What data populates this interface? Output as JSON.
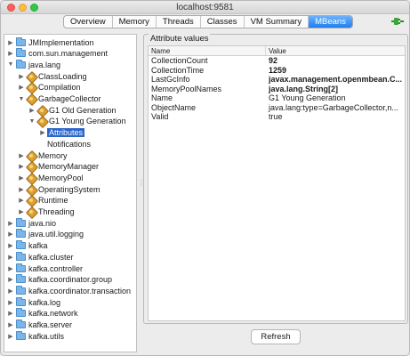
{
  "window": {
    "title": "localhost:9581"
  },
  "tabs": [
    {
      "label": "Overview",
      "active": false
    },
    {
      "label": "Memory",
      "active": false
    },
    {
      "label": "Threads",
      "active": false
    },
    {
      "label": "Classes",
      "active": false
    },
    {
      "label": "VM Summary",
      "active": false
    },
    {
      "label": "MBeans",
      "active": true
    }
  ],
  "tree": [
    {
      "label": "JMImplementation",
      "depth": 0,
      "expanded": false,
      "icon": "folder-icon"
    },
    {
      "label": "com.sun.management",
      "depth": 0,
      "expanded": false,
      "icon": "folder-icon"
    },
    {
      "label": "java.lang",
      "depth": 0,
      "expanded": true,
      "icon": "folder-icon"
    },
    {
      "label": "ClassLoading",
      "depth": 1,
      "expanded": false,
      "icon": "bean-icon"
    },
    {
      "label": "Compilation",
      "depth": 1,
      "expanded": false,
      "icon": "bean-icon"
    },
    {
      "label": "GarbageCollector",
      "depth": 1,
      "expanded": true,
      "icon": "bean-icon"
    },
    {
      "label": "G1 Old Generation",
      "depth": 2,
      "expanded": false,
      "icon": "bean-icon"
    },
    {
      "label": "G1 Young Generation",
      "depth": 2,
      "expanded": true,
      "icon": "bean-icon"
    },
    {
      "label": "Attributes",
      "depth": 3,
      "expanded": false,
      "icon": "none",
      "selected": true
    },
    {
      "label": "Notifications",
      "depth": 3,
      "expanded": null,
      "icon": "none"
    },
    {
      "label": "Memory",
      "depth": 1,
      "expanded": false,
      "icon": "bean-icon"
    },
    {
      "label": "MemoryManager",
      "depth": 1,
      "expanded": false,
      "icon": "bean-icon"
    },
    {
      "label": "MemoryPool",
      "depth": 1,
      "expanded": false,
      "icon": "bean-icon"
    },
    {
      "label": "OperatingSystem",
      "depth": 1,
      "expanded": false,
      "icon": "bean-icon"
    },
    {
      "label": "Runtime",
      "depth": 1,
      "expanded": false,
      "icon": "bean-icon"
    },
    {
      "label": "Threading",
      "depth": 1,
      "expanded": false,
      "icon": "bean-icon"
    },
    {
      "label": "java.nio",
      "depth": 0,
      "expanded": false,
      "icon": "folder-icon"
    },
    {
      "label": "java.util.logging",
      "depth": 0,
      "expanded": false,
      "icon": "folder-icon"
    },
    {
      "label": "kafka",
      "depth": 0,
      "expanded": false,
      "icon": "folder-icon"
    },
    {
      "label": "kafka.cluster",
      "depth": 0,
      "expanded": false,
      "icon": "folder-icon"
    },
    {
      "label": "kafka.controller",
      "depth": 0,
      "expanded": false,
      "icon": "folder-icon"
    },
    {
      "label": "kafka.coordinator.group",
      "depth": 0,
      "expanded": false,
      "icon": "folder-icon"
    },
    {
      "label": "kafka.coordinator.transaction",
      "depth": 0,
      "expanded": false,
      "icon": "folder-icon"
    },
    {
      "label": "kafka.log",
      "depth": 0,
      "expanded": false,
      "icon": "folder-icon"
    },
    {
      "label": "kafka.network",
      "depth": 0,
      "expanded": false,
      "icon": "folder-icon"
    },
    {
      "label": "kafka.server",
      "depth": 0,
      "expanded": false,
      "icon": "folder-icon"
    },
    {
      "label": "kafka.utils",
      "depth": 0,
      "expanded": false,
      "icon": "folder-icon"
    }
  ],
  "attributes": {
    "group_title": "Attribute values",
    "col_name": "Name",
    "col_value": "Value",
    "rows": [
      {
        "name": "CollectionCount",
        "value": "92",
        "bold": true
      },
      {
        "name": "CollectionTime",
        "value": "1259",
        "bold": true
      },
      {
        "name": "LastGcInfo",
        "value": "javax.management.openmbean.C...",
        "bold": true
      },
      {
        "name": "MemoryPoolNames",
        "value": "java.lang.String[2]",
        "bold": true
      },
      {
        "name": "Name",
        "value": "G1 Young Generation",
        "bold": false
      },
      {
        "name": "ObjectName",
        "value": "java.lang:type=GarbageCollector,n...",
        "bold": false
      },
      {
        "name": "Valid",
        "value": "true",
        "bold": false
      }
    ]
  },
  "refresh_label": "Refresh",
  "colors": {
    "selection": "#2b66c8",
    "tab_active": "#1f7ef3"
  }
}
